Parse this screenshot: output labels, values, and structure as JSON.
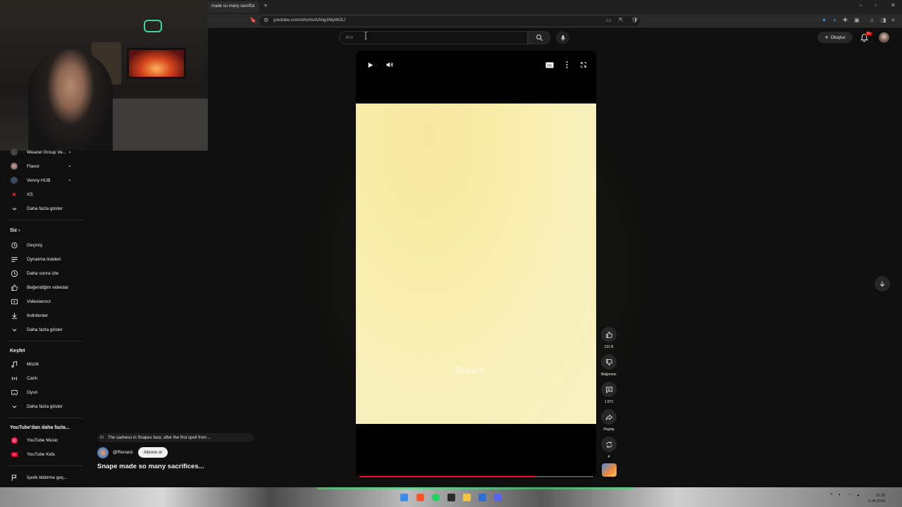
{
  "browser": {
    "tab_title": "made so many sacrifi...",
    "url": "youtube.com/shorts/AAhg1MpW2Ll"
  },
  "header": {
    "search_placeholder": "Ara",
    "create_label": "Oluştur",
    "notification_count": "9+"
  },
  "sidebar": {
    "subscriptions": [
      {
        "label": "Weazel Group Ve...",
        "icon": "channel-avatar",
        "dot": true
      },
      {
        "label": "Flavor",
        "icon": "channel-avatar",
        "dot": true
      },
      {
        "label": "Venny HUB",
        "icon": "channel-avatar",
        "dot": true
      },
      {
        "label": "XS",
        "icon": "channel-avatar",
        "dot": false
      }
    ],
    "show_more_1": "Daha fazla göster",
    "you_heading": "Siz",
    "you_items": [
      {
        "label": "Geçmiş",
        "icon": "history-icon"
      },
      {
        "label": "Oynatma listeleri",
        "icon": "playlist-icon"
      },
      {
        "label": "Daha sonra izle",
        "icon": "clock-icon"
      },
      {
        "label": "Beğendiğim videolar",
        "icon": "like-icon"
      },
      {
        "label": "Videolarınız",
        "icon": "video-icon"
      },
      {
        "label": "İndirilenler",
        "icon": "download-icon"
      }
    ],
    "show_more_2": "Daha fazla göster",
    "explore_heading": "Keşfet",
    "explore_items": [
      {
        "label": "Müzik",
        "icon": "music-icon"
      },
      {
        "label": "Canlı",
        "icon": "live-icon"
      },
      {
        "label": "Oyun",
        "icon": "gaming-icon"
      }
    ],
    "show_more_3": "Daha fazla göster",
    "more_heading": "YouTube'dan daha fazla...",
    "more_items": [
      {
        "label": "YouTube Music",
        "icon": "youtube-music-icon",
        "color": "#ff0033"
      },
      {
        "label": "YouTube Kids",
        "icon": "youtube-kids-icon",
        "color": "#ff0033"
      }
    ],
    "report_label": "İçerik bildirme geç..."
  },
  "short": {
    "watermark": "Renard",
    "music_badge": "M",
    "music_text": "The sadness in Snapes face, after the first spell from ...",
    "channel": "@Renard.",
    "subscribe_label": "Abone ol",
    "title": "Snape made so many sacrifices...",
    "progress": 0.75
  },
  "actions": {
    "likes": "131 B",
    "dislike_label": "Beğenme",
    "comments": "1.971",
    "share_label": "Paylaş",
    "remix_count": "4"
  },
  "taskbar": {
    "time": "22:26",
    "date": "5.04.2026"
  },
  "colors": {
    "accent": "#ff0033",
    "background": "#0f0f0f",
    "video_frame": "#f8efb4"
  }
}
